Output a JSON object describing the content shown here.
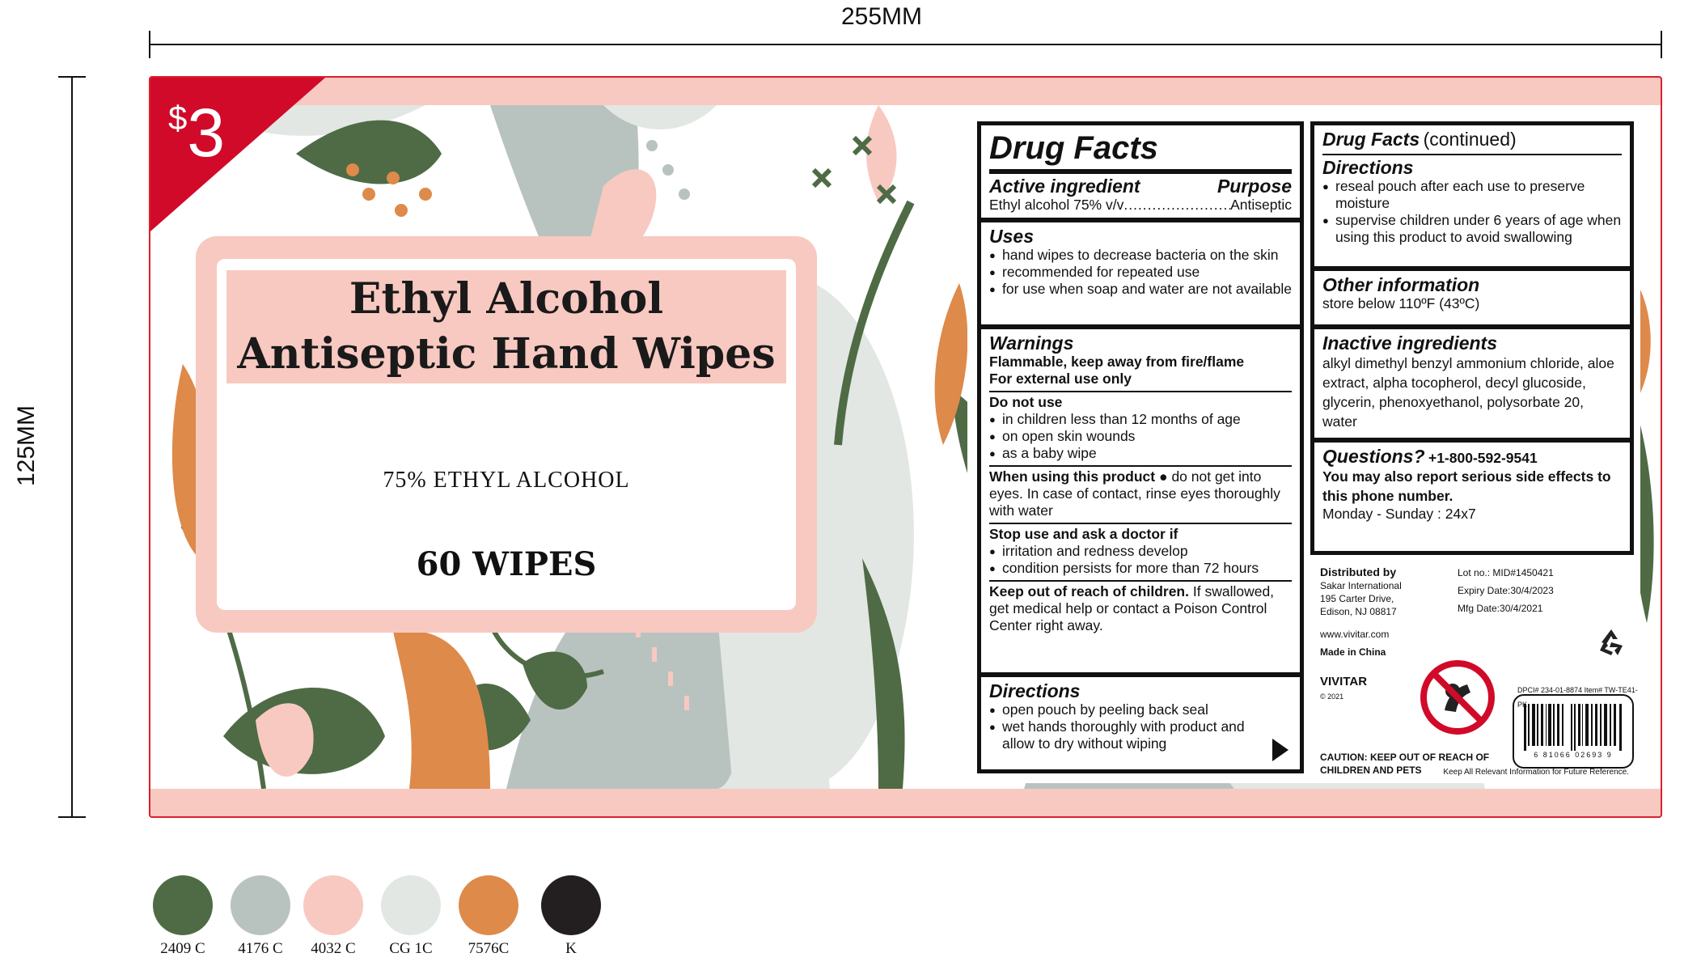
{
  "dimensions": {
    "width_label": "255MM",
    "height_label": "125MM"
  },
  "price": {
    "currency": "$",
    "amount": "3"
  },
  "front": {
    "title_line1": "Ethyl Alcohol",
    "title_line2": "Antiseptic Hand Wipes",
    "concentration": "75% ETHYL ALCOHOL",
    "count": "60 WIPES"
  },
  "drug_facts": {
    "heading": "Drug Facts",
    "active_heading": "Active ingredient",
    "purpose_heading": "Purpose",
    "active_line": "Ethyl alcohol 75% v/v",
    "active_purpose": "Antiseptic",
    "uses_heading": "Uses",
    "uses": [
      "hand wipes to decrease bacteria on the skin",
      "recommended for repeated use",
      "for use when soap and water are not available"
    ],
    "warnings_heading": "Warnings",
    "warning_flammable": "Flammable, keep away from fire/flame",
    "warning_external": "For external use only",
    "do_not_use_heading": "Do not use",
    "do_not_use": [
      "in children less than 12 months of age",
      "on open skin wounds",
      "as a baby wipe"
    ],
    "when_using_heading": "When using this product",
    "when_using_text": "do not get into eyes. In case of contact, rinse eyes thoroughly with water",
    "stop_use_heading": "Stop use and ask a doctor if",
    "stop_use": [
      "irritation and redness develop",
      "condition persists for more than 72 hours"
    ],
    "keep_out_heading": "Keep out of reach of children.",
    "keep_out_text": "If swallowed, get medical help or contact a Poison Control Center right away.",
    "directions_heading": "Directions",
    "directions": [
      "open pouch by peeling back seal",
      "wet hands thoroughly with product and allow to dry without wiping"
    ]
  },
  "drug_facts_continued": {
    "heading": "Drug Facts",
    "heading_suffix": "(continued)",
    "directions_heading": "Directions",
    "directions": [
      "reseal pouch after each use to preserve moisture",
      "supervise children under 6 years of age when using this product to avoid swallowing"
    ],
    "other_heading": "Other information",
    "other_text": "store below 110ºF (43ºC)",
    "inactive_heading": "Inactive ingredients",
    "inactive_text": "alkyl dimethyl benzyl ammonium chloride, aloe extract, alpha tocopherol, decyl glucoside, glycerin, phenoxyethanol, polysorbate 20, water",
    "questions_heading": "Questions?",
    "phone": "+1-800-592-9541",
    "report_text": "You may also report serious side effects to this phone number.",
    "hours": "Monday - Sunday : 24x7"
  },
  "distributor": {
    "heading": "Distributed by",
    "name": "Sakar International",
    "street": "195 Carter Drive,",
    "city": "Edison, NJ 08817",
    "website": "www.vivitar.com",
    "made_in": "Made in China",
    "brand": "VIVITAR",
    "copyright": "© 2021",
    "lot": "Lot no.: MID#1450421",
    "expiry_label": "Expiry Date:",
    "expiry": "30/4/2023",
    "mfg_label": "Mfg Date:",
    "mfg": "30/4/2021",
    "dpci": "DPCI# 234-01-8874",
    "item": "Item# TW-TE41-PK",
    "barcode_digits": "6 81066 02693 9",
    "caution": "CAUTION: KEEP OUT OF REACH OF CHILDREN AND PETS",
    "keep_info": "Keep All Relevant Information for Future Reference."
  },
  "icons": {
    "recycle": "recycle-icon",
    "no_eating": "no-eating-icon",
    "barcode": "barcode-icon"
  },
  "colors": {
    "frame_red": "#d9202e",
    "price_red": "#d10a2a",
    "pink": "#f8c9c1",
    "green": "#4e6b45",
    "sage": "#b8c3bf",
    "light": "#e2e7e3",
    "orange": "#de8a4a",
    "black": "#231f20"
  },
  "swatches": [
    {
      "label": "2409  C",
      "color": "#4e6b45"
    },
    {
      "label": "4176  C",
      "color": "#b8c3bf"
    },
    {
      "label": "4032  C",
      "color": "#f8c9c1"
    },
    {
      "label": "CG 1C",
      "color": "#e2e7e3"
    },
    {
      "label": "7576C",
      "color": "#de8a4a"
    },
    {
      "label": "K",
      "color": "#231f20"
    }
  ]
}
